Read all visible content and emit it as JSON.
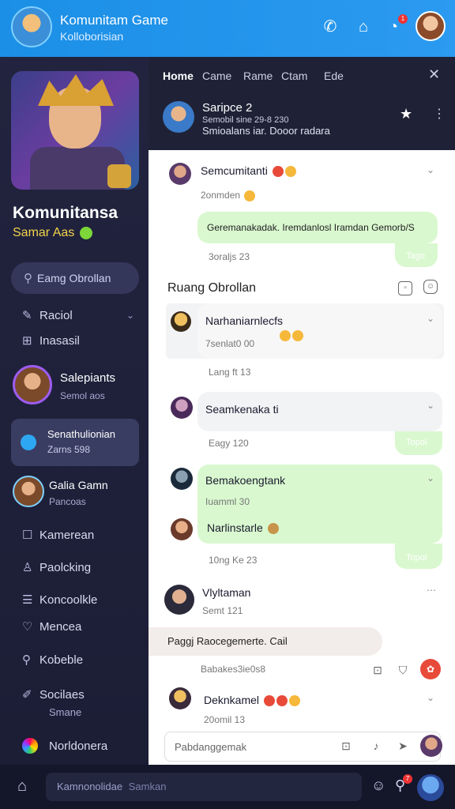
{
  "app": {
    "title": "Komunitam Game",
    "subtitle": "Kolloborisian"
  },
  "topbar": {
    "icons": [
      "phone-icon",
      "home-icon",
      "notification-icon"
    ],
    "notification_badge": "1",
    "avatar": "user-avatar"
  },
  "sidebar": {
    "brand_title": "Komunitansa",
    "brand_sub": "Samar Aas",
    "search_label": "Eamg Obrollan",
    "nav1": [
      {
        "label": "Raciol",
        "icon": "pen-icon"
      },
      {
        "label": "Inasasil",
        "icon": "gift-icon"
      }
    ],
    "profile": {
      "title": "Salepiants",
      "sub": "Semol aos"
    },
    "active_item": {
      "title": "Senathulionian",
      "sub": "Zarns 598"
    },
    "game": {
      "title": "Galia Gamn",
      "sub": "Pancoas"
    },
    "nav2": [
      {
        "label": "Kamerean",
        "icon": "doc-icon"
      },
      {
        "label": "Paolcking",
        "icon": "user-icon"
      },
      {
        "label": "Koncoolkle",
        "icon": "chat-icon"
      },
      {
        "label": "Mencea",
        "icon": "heart-icon"
      },
      {
        "label": "Kobeble",
        "icon": "search-icon"
      }
    ],
    "settings": {
      "title": "Socilaes",
      "sub": "Smane"
    },
    "last_item": "Norldonera"
  },
  "chat": {
    "tabs": [
      "Home",
      "Came",
      "Rame",
      "Ctam",
      "Ede"
    ],
    "conversation": {
      "title": "Saripce 2",
      "meta": "Semobil sine 29-8 230",
      "sub": "Smioalans iar. Dooor radara"
    },
    "msg1": {
      "name": "Semcumitanti",
      "time": "2onmden",
      "bubble": "Geremanakadak. Iremdanlosl Iramdan Gemorb/S",
      "bubble_time": "Tago",
      "stamp": "3oraljs 23"
    },
    "section_title": "Ruang Obrollan",
    "msg2": {
      "name": "Narhaniarnlecfs",
      "time": "7senlat0 00",
      "stamp": "Lang ft 13"
    },
    "msg3": {
      "name": "Seamkenaka ti",
      "time": "Eagy 120",
      "tick": "Topol"
    },
    "msg4": {
      "name": "Bemakoengtank",
      "time": "Iuamml 30",
      "name2": "Narlinstarle",
      "tick": "Topol",
      "stamp": "10ng Ke 23"
    },
    "msg5": {
      "name": "Vlyltaman",
      "time": "Semt 121"
    },
    "pink_bar": "Paggj Raocegemerte. Cail",
    "action_row_label": "Babakes3ie0s8",
    "msg6": {
      "name": "Deknkamel",
      "time": "20omil 13"
    },
    "composer_placeholder": "Pabdanggemak"
  },
  "bottombar": {
    "input_label": "Kamnonolidae",
    "input_hint": "Samkan",
    "badge": "7"
  }
}
